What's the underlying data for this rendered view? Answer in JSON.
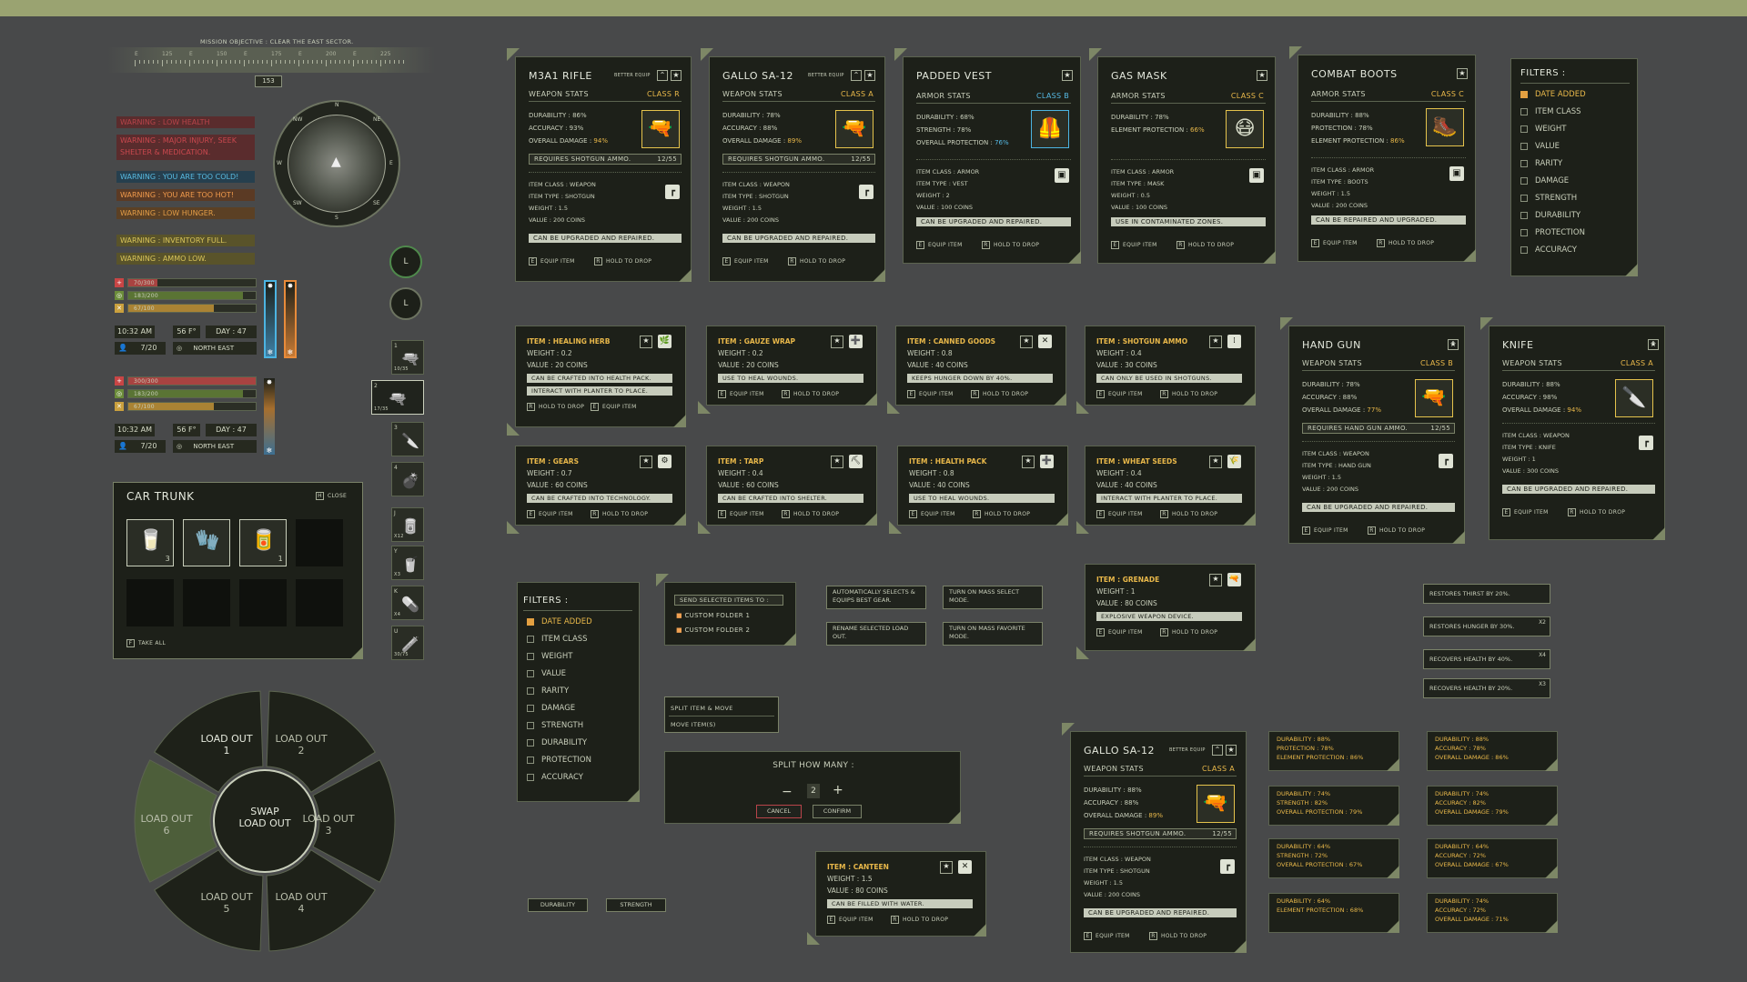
{
  "mission": "MISSION OBJECTIVE : CLEAR THE EAST SECTOR.",
  "compass": {
    "ticks": [
      "E",
      "125",
      "E",
      "150",
      "E",
      "175",
      "E",
      "200",
      "E",
      "225"
    ],
    "heading": "153",
    "labels": [
      "N",
      "NE",
      "E",
      "SE",
      "S",
      "SW",
      "W",
      "NW"
    ]
  },
  "warnings": [
    {
      "text": "WARNING : LOW HEALTH",
      "color": "#b8444a",
      "bg": "#5a2c2d"
    },
    {
      "text": "WARNING : MAJOR INJURY, SEEK SHELTER & MEDICATION.",
      "color": "#c9484e",
      "bg": "#5a2c2d"
    },
    {
      "text": "WARNING : YOU ARE TOO COLD!",
      "color": "#58bbe2",
      "bg": "#263f4e"
    },
    {
      "text": "WARNING : YOU ARE TOO HOT!",
      "color": "#f09a4c",
      "bg": "#5b3a24"
    },
    {
      "text": "WARNING : LOW HUNGER.",
      "color": "#e39d47",
      "bg": "#5b4024"
    },
    {
      "text": "WARNING : INVENTORY FULL.",
      "color": "#d9c55a",
      "bg": "#59532a"
    },
    {
      "text": "WARNING : AMMO LOW.",
      "color": "#d9c55a",
      "bg": "#59532a"
    }
  ],
  "hud": [
    {
      "health": "70/300",
      "health_frac": 0.23,
      "hunger": "183/200",
      "hunger_frac": 0.9,
      "thirst": "67/100",
      "thirst_frac": 0.67,
      "time": "10:32 AM",
      "temp": "56 F°",
      "day": "DAY : 47",
      "count": "7/20",
      "dir": "NORTH EAST"
    },
    {
      "health": "300/300",
      "health_frac": 1.0,
      "hunger": "183/200",
      "hunger_frac": 0.9,
      "thirst": "67/100",
      "thirst_frac": 0.67,
      "time": "10:32 AM",
      "temp": "56 F°",
      "day": "DAY : 47",
      "count": "7/20",
      "dir": "NORTH EAST"
    }
  ],
  "trunk": {
    "title": "CAR TRUNK",
    "close": "CLOSE",
    "close_key": "H",
    "take": "TAKE ALL",
    "take_key": "F",
    "items": [
      {
        "icon": "🥛",
        "count": "3"
      },
      {
        "icon": "🧤",
        "count": ""
      },
      {
        "icon": "🥫",
        "count": "1"
      }
    ]
  },
  "loadout": {
    "center": "SWAP\nLOAD OUT",
    "items": [
      "LOAD OUT\n1",
      "LOAD OUT\n2",
      "LOAD OUT\n3",
      "LOAD OUT\n4",
      "LOAD OUT\n5",
      "LOAD OUT\n6"
    ]
  },
  "quick": {
    "keys": [
      "L",
      "L"
    ],
    "slots": [
      {
        "n": "1",
        "c": "10/35",
        "i": "🔫"
      },
      {
        "n": "2",
        "c": "17/35",
        "i": "🔫"
      },
      {
        "n": "3",
        "c": "",
        "i": "🔪"
      },
      {
        "n": "4",
        "c": "",
        "i": "💣"
      },
      {
        "n": "J",
        "c": "x12",
        "i": "🥫"
      },
      {
        "n": "Y",
        "c": "x3",
        "i": "🥤"
      },
      {
        "n": "K",
        "c": "x4",
        "i": "💊"
      },
      {
        "n": "U",
        "c": "30/75",
        "i": "🧪"
      }
    ]
  },
  "labels": {
    "better": "BETTER EQUIP",
    "equip": "EQUIP ITEM",
    "drop": "HOLD TO DROP",
    "equip_key": "E",
    "drop_key": "R"
  },
  "weapons": [
    {
      "name": "M3A1 RIFLE",
      "stats_title": "WEAPON STATS",
      "cls": "CLASS R",
      "dur": "DURABILITY : 86%",
      "acc": "ACCURACY : 93%",
      "dmg_l": "OVERALL DAMAGE : ",
      "dmg": "94%",
      "ammo": "REQUIRES SHOTGUN AMMO.",
      "ammo_c": "12/55",
      "itemclass": "ITEM CLASS : WEAPON",
      "type": "ITEM TYPE : SHOTGUN",
      "weight": "WEIGHT : 1.5",
      "value": "VALUE : 200 COINS",
      "note": "CAN BE UPGRADED AND REPAIRED.",
      "icon": "🔫"
    },
    {
      "name": "GALLO SA-12",
      "stats_title": "WEAPON STATS",
      "cls": "CLASS A",
      "dur": "DURABILITY : 78%",
      "acc": "ACCURACY : 88%",
      "dmg_l": "OVERALL DAMAGE : ",
      "dmg": "89%",
      "ammo": "REQUIRES SHOTGUN AMMO.",
      "ammo_c": "12/55",
      "itemclass": "ITEM CLASS : WEAPON",
      "type": "ITEM TYPE : SHOTGUN",
      "weight": "WEIGHT : 1.5",
      "value": "VALUE : 200 COINS",
      "note": "CAN BE UPGRADED AND REPAIRED.",
      "icon": "🔫"
    }
  ],
  "armor": [
    {
      "name": "PADDED VEST",
      "stats_title": "ARMOR STATS",
      "cls": "CLASS B",
      "s1": "DURABILITY : 68%",
      "s2": "STRENGTH : 78%",
      "s3l": "OVERALL PROTECTION : ",
      "s3": "76%",
      "itemclass": "ITEM CLASS : ARMOR",
      "type": "ITEM TYPE : VEST",
      "weight": "WEIGHT : 2",
      "value": "VALUE : 100 COINS",
      "note": "CAN BE UPGRADED AND REPAIRED.",
      "icon": "🦺"
    },
    {
      "name": "GAS MASK",
      "stats_title": "ARMOR STATS",
      "cls": "CLASS C",
      "s1": "DURABILITY : 78%",
      "s2": "",
      "s3l": "ELEMENT PROTECTION : ",
      "s3": "66%",
      "itemclass": "ITEM CLASS : ARMOR",
      "type": "ITEM TYPE : MASK",
      "weight": "WEIGHT : 0.5",
      "value": "VALUE : 100 COINS",
      "note": "USE IN CONTAMINATED ZONES.",
      "icon": "😷"
    },
    {
      "name": "COMBAT BOOTS",
      "stats_title": "ARMOR STATS",
      "cls": "CLASS C",
      "s1": "DURABILITY : 88%",
      "s2": "PROTECTION : 78%",
      "s3l": "ELEMENT PROTECTION : ",
      "s3": "86%",
      "itemclass": "ITEM CLASS : ARMOR",
      "type": "ITEM TYPE : BOOTS",
      "weight": "WEIGHT : 1.5",
      "value": "VALUE : 200 COINS",
      "note": "CAN BE REPAIRED AND UPGRADED.",
      "icon": "🥾"
    }
  ],
  "filters": {
    "title": "FILTERS :",
    "items": [
      "DATE ADDED",
      "ITEM CLASS",
      "WEIGHT",
      "VALUE",
      "RARITY",
      "DAMAGE",
      "STRENGTH",
      "DURABILITY",
      "PROTECTION",
      "ACCURACY"
    ]
  },
  "small_items": [
    {
      "name": "ITEM : HEALING HERB",
      "weight": "WEIGHT : 0.2",
      "value": "VALUE : 20 COINS",
      "notes": [
        "CAN BE CRAFTED INTO HEALTH PACK.",
        "INTERACT WITH PLANTER TO PLACE."
      ],
      "icon": "🌿"
    },
    {
      "name": "ITEM : GAUZE WRAP",
      "weight": "WEIGHT : 0.2",
      "value": "VALUE : 20 COINS",
      "notes": [
        "USE TO HEAL WOUNDS."
      ],
      "icon": "➕"
    },
    {
      "name": "ITEM : CANNED GOODS",
      "weight": "WEIGHT : 0.8",
      "value": "VALUE : 40 COINS",
      "notes": [
        "KEEPS HUNGER DOWN BY 40%."
      ],
      "icon": "✕"
    },
    {
      "name": "ITEM : SHOTGUN AMMO",
      "weight": "WEIGHT : 0.4",
      "value": "VALUE : 30 COINS",
      "notes": [
        "CAN ONLY BE USED IN SHOTGUNS."
      ],
      "icon": "⁞"
    },
    {
      "name": "ITEM : GEARS",
      "weight": "WEIGHT : 0.7",
      "value": "VALUE : 60 COINS",
      "notes": [
        "CAN BE CRAFTED INTO TECHNOLOGY."
      ],
      "icon": "⚙"
    },
    {
      "name": "ITEM : TARP",
      "weight": "WEIGHT : 0.4",
      "value": "VALUE : 60 COINS",
      "notes": [
        "CAN BE CRAFTED INTO SHELTER."
      ],
      "icon": "⛏"
    },
    {
      "name": "ITEM : HEALTH PACK",
      "weight": "WEIGHT : 0.8",
      "value": "VALUE : 40 COINS",
      "notes": [
        "USE TO HEAL WOUNDS."
      ],
      "icon": "➕"
    },
    {
      "name": "ITEM : WHEAT SEEDS",
      "weight": "WEIGHT : 0.4",
      "value": "VALUE : 40 COINS",
      "notes": [
        "INTERACT WITH PLANTER TO PLACE."
      ],
      "icon": "🌾"
    },
    {
      "name": "ITEM : GRENADE",
      "weight": "WEIGHT : 1",
      "value": "VALUE : 80 COINS",
      "notes": [
        "EXPLOSIVE WEAPON DEVICE."
      ],
      "icon": "🔫"
    },
    {
      "name": "ITEM : CANTEEN",
      "weight": "WEIGHT : 1.5",
      "value": "VALUE : 80 COINS",
      "notes": [
        "CAN BE FILLED WITH WATER."
      ],
      "icon": "✕"
    }
  ],
  "weapons2": [
    {
      "name": "HAND GUN",
      "stats_title": "WEAPON STATS",
      "cls": "CLASS B",
      "dur": "DURABILITY : 78%",
      "acc": "ACCURACY : 88%",
      "dmg_l": "OVERALL DAMAGE : ",
      "dmg": "77%",
      "ammo": "REQUIRES HAND GUN AMMO.",
      "ammo_c": "12/55",
      "itemclass": "ITEM CLASS : WEAPON",
      "type": "ITEM TYPE : HAND GUN",
      "weight": "WEIGHT : 1.5",
      "value": "VALUE : 200 COINS",
      "note": "CAN BE UPGRADED AND REPAIRED.",
      "icon": "🔫"
    },
    {
      "name": "KNIFE",
      "stats_title": "WEAPON STATS",
      "cls": "CLASS A",
      "dur": "DURABILITY : 88%",
      "acc": "ACCURACY : 98%",
      "dmg_l": "OVERALL DAMAGE : ",
      "dmg": "94%",
      "ammo": "",
      "ammo_c": "",
      "itemclass": "ITEM CLASS : WEAPON",
      "type": "ITEM TYPE : KNIFE",
      "weight": "WEIGHT : 1",
      "value": "VALUE : 300 COINS",
      "note": "CAN BE UPGRADED AND REPAIRED.",
      "icon": "🔪"
    },
    {
      "name": "GALLO SA-12",
      "stats_title": "WEAPON STATS",
      "cls": "CLASS A",
      "dur": "DURABILITY : 88%",
      "acc": "ACCURACY : 88%",
      "dmg_l": "OVERALL DAMAGE : ",
      "dmg": "89%",
      "ammo": "REQUIRES SHOTGUN AMMO.",
      "ammo_c": "12/55",
      "itemclass": "ITEM CLASS : WEAPON",
      "type": "ITEM TYPE : SHOTGUN",
      "weight": "WEIGHT : 1.5",
      "value": "VALUE : 200 COINS",
      "note": "CAN BE UPGRADED AND REPAIRED.",
      "icon": "🔫"
    }
  ],
  "send": {
    "title": "SEND SELECTED ITEMS TO :",
    "folders": [
      "CUSTOM FOLDER 1",
      "CUSTOM FOLDER 2"
    ]
  },
  "hints": [
    "AUTOMATICALLY SELECTS & EQUIPS BEST GEAR.",
    "TURN ON MASS SELECT MODE.",
    "RENAME SELECTED LOAD OUT.",
    "TURN ON MASS FAVORITE MODE."
  ],
  "split_menu": [
    "SPLIT ITEM & MOVE",
    "MOVE ITEM(S)"
  ],
  "split": {
    "title": "SPLIT HOW MANY :",
    "minus": "−",
    "value": "2",
    "plus": "+",
    "cancel": "CANCEL",
    "confirm": "CONFIRM"
  },
  "bottom_tags": [
    "DURABILITY",
    "STRENGTH"
  ],
  "buffs": [
    {
      "t": "RESTORES THIRST BY 20%.",
      "m": ""
    },
    {
      "t": "RESTORES HUNGER BY 30%.",
      "m": "x2"
    },
    {
      "t": "RECOVERS HEALTH BY 40%.",
      "m": "x4"
    },
    {
      "t": "RECOVERS HEALTH BY 20%.",
      "m": "x3"
    }
  ],
  "compare_left": [
    [
      "DURABILITY : 88%",
      "PROTECTION : 78%",
      "ELEMENT PROTECTION : 86%"
    ],
    [
      "DURABILITY : 74%",
      "STRENGTH : 82%",
      "OVERALL PROTECTION : 79%"
    ],
    [
      "DURABILITY : 64%",
      "STRENGTH : 72%",
      "OVERALL PROTECTION : 67%"
    ],
    [
      "DURABILITY : 64%",
      "ELEMENT PROTECTION : 68%"
    ]
  ],
  "compare_right": [
    [
      "DURABILITY : 88%",
      "ACCURACY : 78%",
      "OVERALL DAMAGE : 86%"
    ],
    [
      "DURABILITY : 74%",
      "ACCURACY : 82%",
      "OVERALL DAMAGE : 79%"
    ],
    [
      "DURABILITY : 64%",
      "ACCURACY : 72%",
      "OVERALL DAMAGE : 67%"
    ],
    [
      "DURABILITY : 74%",
      "ACCURACY : 72%",
      "OVERALL DAMAGE : 71%"
    ]
  ]
}
